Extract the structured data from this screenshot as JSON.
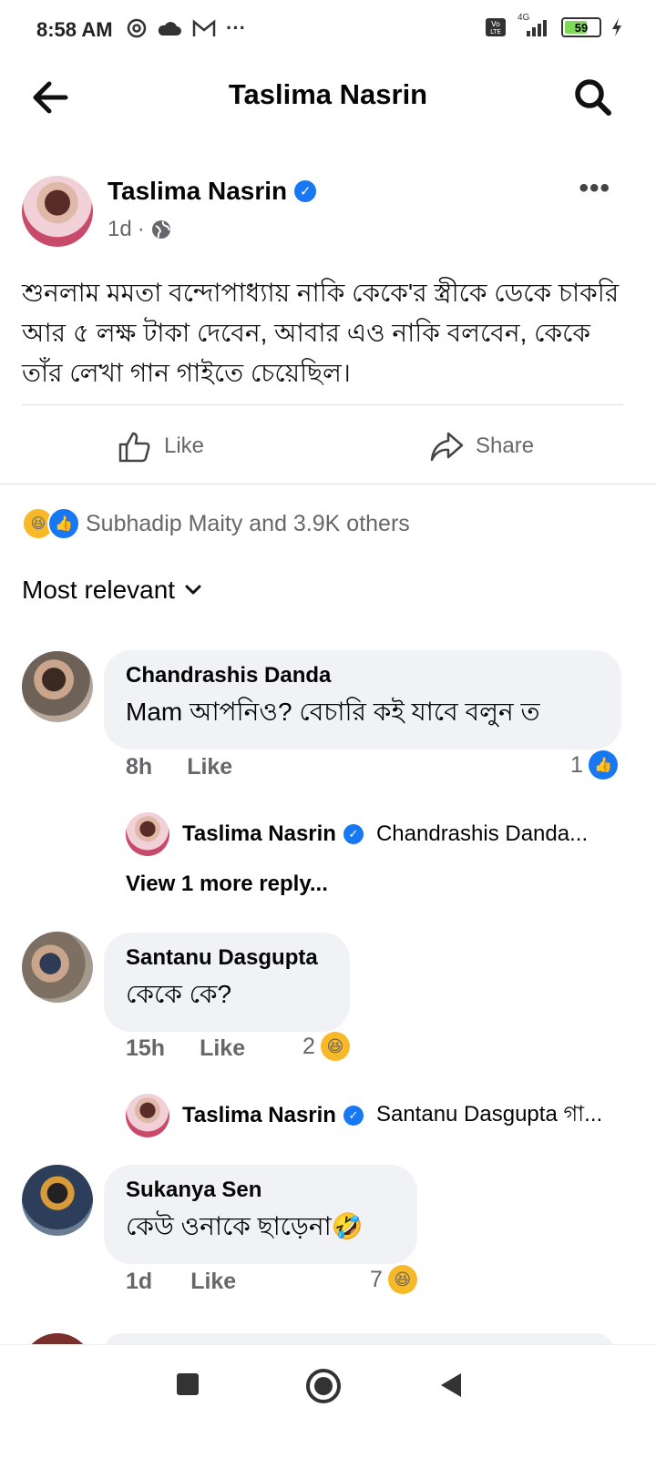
{
  "status_bar": {
    "time": "8:58 AM",
    "battery": "59",
    "network": "4G"
  },
  "header": {
    "title": "Taslima Nasrin"
  },
  "post": {
    "author": "Taslima Nasrin",
    "time": "1d",
    "text": "শুনলাম মমতা বন্দোপাধ্যায় নাকি কেকে'র স্ত্রীকে ডেকে  চাকরি আর ৫ লক্ষ টাকা দেবেন, আবার এও নাকি বলবেন, কেকে তাঁর লেখা গান গাইতে চেয়েছিল।",
    "like_label": "Like",
    "share_label": "Share",
    "reactions_text": "Subhadip Maity and 3.9K others"
  },
  "sort_label": "Most relevant",
  "comments": [
    {
      "name": "Chandrashis Danda",
      "text": "Mam  আপনিও? বেচারি কই যাবে বলুন ত",
      "time": "8h",
      "like_label": "Like",
      "reaction_count": "1",
      "reply": {
        "name": "Taslima Nasrin",
        "snippet": "Chandrashis Danda...",
        "view_more": "View 1 more reply..."
      }
    },
    {
      "name": "Santanu Dasgupta",
      "text": "কেকে কে?",
      "time": "15h",
      "like_label": "Like",
      "reaction_count": "2",
      "reply": {
        "name": "Taslima Nasrin",
        "snippet": "Santanu Dasgupta গা..."
      }
    },
    {
      "name": "Sukanya Sen",
      "text": "কেউ ওনাকে ছাড়েনা🤣",
      "time": "1d",
      "like_label": "Like",
      "reaction_count": "7"
    }
  ],
  "colors": {
    "accent": "#1877f2",
    "bubble": "#f0f2f5",
    "meta": "#65676b"
  }
}
